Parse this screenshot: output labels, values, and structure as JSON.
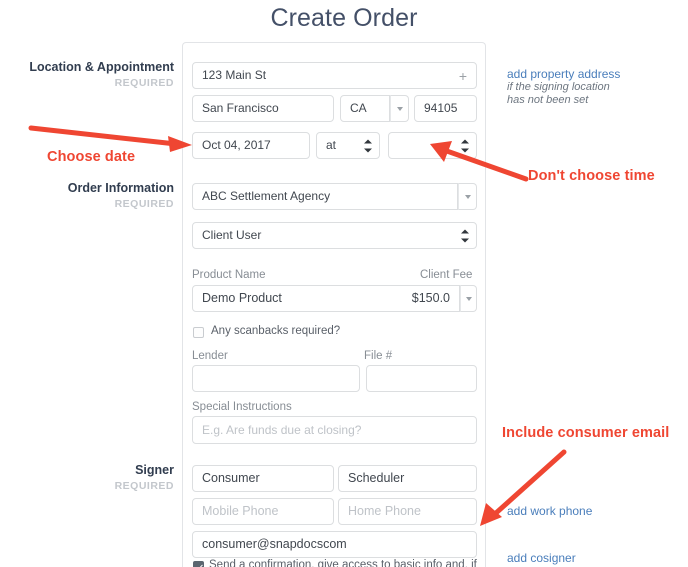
{
  "page": {
    "title": "Create Order",
    "accent_blue": "#4a7ebb",
    "annotation_red": "#ef4632"
  },
  "sections": [
    {
      "title": "Location & Appointment",
      "required": "REQUIRED"
    },
    {
      "title": "Order Information",
      "required": "REQUIRED"
    },
    {
      "title": "Signer",
      "required": "REQUIRED"
    }
  ],
  "location": {
    "street": "123 Main St",
    "street_add_icon": "plus-icon",
    "city": "San Francisco",
    "state": "CA",
    "zip": "94105",
    "date": "Oct 04, 2017",
    "at_label": "at",
    "time": ""
  },
  "order": {
    "agency": "ABC Settlement Agency",
    "contact": "Client User",
    "product_name_label": "Product Name",
    "client_fee_label": "Client Fee",
    "product_name": "Demo Product",
    "client_fee": "$150.0",
    "scanbacks_label": "Any scanbacks required?",
    "scanbacks_checked": false,
    "lender_label": "Lender",
    "lender_value": "",
    "file_label": "File #",
    "file_value": "",
    "special_instructions_label": "Special Instructions",
    "special_instructions_placeholder": "E.g. Are funds due at closing?",
    "special_instructions_value": ""
  },
  "signer": {
    "first_name": "Consumer",
    "last_name": "Scheduler",
    "mobile_phone_placeholder": "Mobile Phone",
    "mobile_phone_value": "",
    "home_phone_placeholder": "Home Phone",
    "home_phone_value": "",
    "email": "consumer@snapdocscom",
    "confirmation_checked": true,
    "confirmation_text": "Send a confirmation, give access to basic info and, if"
  },
  "help": {
    "add_property_address": "add property address",
    "property_note_line1": "if the signing location",
    "property_note_line2": "has not been set",
    "add_work_phone": "add work phone",
    "add_cosigner": "add cosigner"
  },
  "annotations": [
    {
      "text": "Choose date"
    },
    {
      "text": "Don't choose time"
    },
    {
      "text": "Include consumer email"
    }
  ]
}
